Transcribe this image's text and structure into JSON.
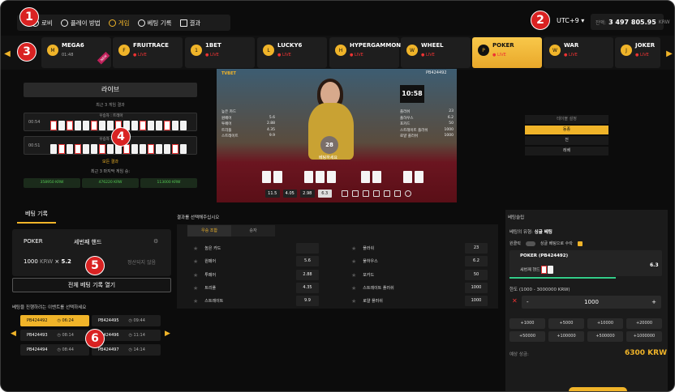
{
  "nav": {
    "items": [
      {
        "label": "로비",
        "icon": "home-icon"
      },
      {
        "label": "플레이 방법",
        "icon": "info-icon"
      },
      {
        "label": "게임",
        "icon": "game-icon",
        "active": true
      },
      {
        "label": "베팅 기록",
        "icon": "history-icon"
      },
      {
        "label": "결과",
        "icon": "calendar-icon"
      }
    ]
  },
  "header": {
    "timezone": "UTC+9 ▾",
    "balance_label": "잔액:",
    "balance": "3 497 805.95",
    "currency": "KRW"
  },
  "game_tabs": [
    {
      "name": "MEGA6",
      "sub": "01:48",
      "badge": "NEW"
    },
    {
      "name": "FRUITRACE",
      "sub": "● LIVE"
    },
    {
      "name": "1BET",
      "sub": "● LIVE"
    },
    {
      "name": "LUCKY6",
      "sub": "● LIVE"
    },
    {
      "name": "HYPERGAMMON",
      "sub": "● LIVE"
    },
    {
      "name": "WHEEL",
      "sub": "● LIVE"
    },
    {
      "name": "POKER",
      "sub": "● LIVE",
      "active": true
    },
    {
      "name": "WAR",
      "sub": "● LIVE"
    },
    {
      "name": "JOKER",
      "sub": "● LIVE"
    }
  ],
  "live": {
    "label": "라이브",
    "results_title": "최근 3 게임 결과",
    "row1": {
      "time": "00:54",
      "label": "우승자 : 트레아"
    },
    "row2": {
      "time": "00:51",
      "label": "우승자 : 트레아"
    },
    "all_results": "모든 결과",
    "last_wins_title": "최근 3 마지막 게임 승:",
    "wins": [
      "358950 KRW",
      "476220 KRW",
      "113000 KRW"
    ]
  },
  "video": {
    "logo": "TVBET",
    "id": "PB424492",
    "clock": "10:58",
    "timer": "28",
    "prompt": "베팅하세요",
    "left_table": [
      [
        "높은 카드",
        ""
      ],
      [
        "원페어",
        "5.6"
      ],
      [
        "투페어",
        "2.88"
      ],
      [
        "트리플",
        "4.35"
      ],
      [
        "스트레이트",
        "9.9"
      ]
    ],
    "right_table": [
      [
        "플러쉬",
        "23"
      ],
      [
        "풀하우스",
        "6.2"
      ],
      [
        "포카드",
        "50"
      ],
      [
        "스트레이트 플러쉬",
        "1000"
      ],
      [
        "로얄 플러쉬",
        "1000"
      ]
    ],
    "odds": [
      "11.5",
      "4.05",
      "2.98",
      "6.3"
    ]
  },
  "right_mini": {
    "title": "테이블 설정",
    "options": [
      "동종",
      "전",
      "레베"
    ]
  },
  "history": {
    "tab": "베팅 기록",
    "game": "POKER",
    "hand": "세번째 핸드",
    "amount_prefix": "1000 ",
    "amount_cur": "KRW",
    "amount_mult": " × ",
    "amount_odds": "5.2",
    "status": "정산되지 않음",
    "all_button": "전체 베팅 기록 열기",
    "hint": "베팅을 진행하려는 이벤트를 선택하세요",
    "events": [
      {
        "id": "PB424492",
        "time": "◷ 06:24",
        "sel": true
      },
      {
        "id": "PB424495",
        "time": "◷ 09:44"
      },
      {
        "id": "PB424493",
        "time": "◷ 08:14"
      },
      {
        "id": "PB424496",
        "time": "◷ 11:14"
      },
      {
        "id": "PB424494",
        "time": "◷ 08:44"
      },
      {
        "id": "PB424497",
        "time": "◷ 14:14"
      }
    ]
  },
  "bets": {
    "title": "결과를 선택해주십시오",
    "tabs": [
      "우승 조합",
      "승자"
    ],
    "left": [
      [
        "높은 카드",
        ""
      ],
      [
        "원페어",
        "5.6"
      ],
      [
        "투페어",
        "2.88"
      ],
      [
        "트리플",
        "4.35"
      ],
      [
        "스트레이트",
        "9.9"
      ]
    ],
    "right": [
      [
        "플러쉬",
        "23"
      ],
      [
        "풀하우스",
        "6.2"
      ],
      [
        "포카드",
        "50"
      ],
      [
        "스트레이트 플러쉬",
        "1000"
      ],
      [
        "로얄 플러쉬",
        "1000"
      ]
    ]
  },
  "slip": {
    "title": "베팅슬립",
    "type_label": "베팅의 유형:",
    "type_value": "싱글 베팅",
    "toggle1": "원클릭",
    "toggle2": "싱글 베팅으로 수락",
    "bet_id": "POKER (PB424492)",
    "bet_hand": "세번째 핸드",
    "bet_odds": "6.3",
    "range": "한도 (1000 - 3000000 KRW)",
    "stake": "1000",
    "chips": [
      "+1000",
      "+5000",
      "+10000",
      "+20000",
      "+50000",
      "+100000",
      "+500000",
      "+1000000"
    ],
    "pay_label": "예상 상금:",
    "pay_value": "6300 KRW"
  },
  "annotations": [
    "1",
    "2",
    "3",
    "4",
    "5",
    "6"
  ],
  "colors": {
    "accent": "#f0b429",
    "live": "#e33333",
    "badge": "#d92222"
  }
}
